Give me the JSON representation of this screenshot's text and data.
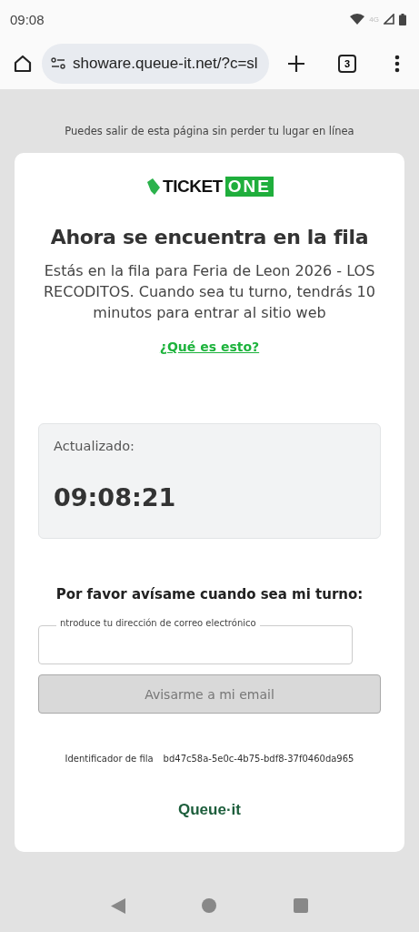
{
  "status_bar": {
    "time": "09:08",
    "network": "4G"
  },
  "browser": {
    "url": "showare.queue-it.net/?c=sl",
    "tab_count": "3"
  },
  "notice": "Puedes salir de esta página sin perder tu lugar en línea",
  "card": {
    "logo": {
      "word1": "TICKET",
      "word2": "ONE"
    },
    "heading": "Ahora se encuentra en la fila",
    "message": "Estás en la fila para Feria de Leon 2026 - LOS RECODITOS. Cuando sea tu turno, tendrás 10 minutos para entrar al sitio web",
    "help_link": "¿Qué es esto?",
    "updated_label": "Actualizado:",
    "updated_time": "09:08:21",
    "notify_heading": "Por favor avísame cuando sea mi turno:",
    "email_field": {
      "label": "ntroduce tu dirección de correo electrónico"
    },
    "notify_button": {
      "label": "Avisarme a mi email",
      "disabled": true
    },
    "queue_id_label": "Identificador de fila",
    "queue_id": "bd47c58a-5e0c-4b75-bdf8-37f0460da965",
    "footer_logo": "Queue·it"
  }
}
